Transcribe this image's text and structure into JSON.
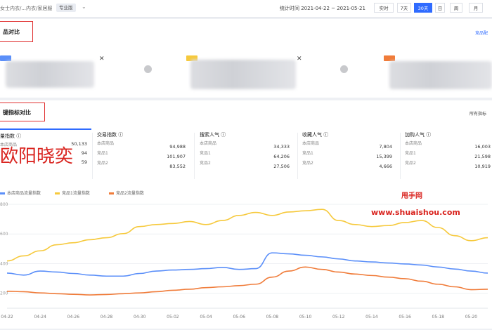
{
  "topbar": {
    "breadcrumb": "女士内衣/...内衣/家居服",
    "badge": "专业版",
    "stat_time": "统计时间 2021-04-22 ~ 2021-05-21",
    "time_buttons": [
      "实时",
      "7天",
      "30天",
      "日",
      "周",
      "月"
    ],
    "active_button": "30天"
  },
  "product_compare": {
    "title": "品对比",
    "link": "竞品配",
    "cards": [
      {
        "tag_color": "#5b8ff9"
      },
      {
        "tag_color": "#f6c93c"
      },
      {
        "tag_color": "#f07c3a"
      }
    ]
  },
  "metric_compare": {
    "title": "键指标对比",
    "link": "所有指标",
    "row_labels": [
      "本店商品",
      "竞品1",
      "竞品2"
    ],
    "metrics": [
      {
        "name": "量指数 ⓘ",
        "values": [
          "50,133",
          "94",
          "59"
        ]
      },
      {
        "name": "交易指数 ⓘ",
        "values": [
          "94,988",
          "101,907",
          "83,552"
        ]
      },
      {
        "name": "搜索人气 ⓘ",
        "values": [
          "34,333",
          "64,206",
          "27,506"
        ]
      },
      {
        "name": "收藏人气 ⓘ",
        "values": [
          "7,804",
          "15,399",
          "4,666"
        ]
      },
      {
        "name": "加购人气 ⓘ",
        "values": [
          "16,003",
          "21,598",
          "10,919"
        ]
      }
    ]
  },
  "watermarks": {
    "name": "欧阳晓奕",
    "site_cn": "甩手网",
    "site_url": "www.shuaishou.com"
  },
  "chart_data": {
    "type": "line",
    "x": [
      "04-22",
      "04-23",
      "04-24",
      "04-25",
      "04-26",
      "04-27",
      "04-28",
      "04-29",
      "04-30",
      "05-01",
      "05-02",
      "05-03",
      "05-04",
      "05-05",
      "05-06",
      "05-07",
      "05-08",
      "05-09",
      "05-10",
      "05-11",
      "05-12",
      "05-13",
      "05-14",
      "05-15",
      "05-16",
      "05-17",
      "05-18",
      "05-19",
      "05-20",
      "05-21"
    ],
    "x_tick_labels": [
      "04-22",
      "04-24",
      "04-26",
      "04-28",
      "04-30",
      "05-02",
      "05-04",
      "05-06",
      "05-08",
      "05-10",
      "05-12",
      "05-14",
      "05-16",
      "05-18",
      "05-20"
    ],
    "y_tick_labels": [
      "800",
      "600",
      "400",
      "200"
    ],
    "series": [
      {
        "name": "本店商品流量指数",
        "color": "#5b8ff9",
        "values": [
          460,
          450,
          470,
          465,
          458,
          450,
          445,
          445,
          458,
          470,
          475,
          478,
          482,
          488,
          478,
          482,
          560,
          555,
          548,
          540,
          530,
          520,
          515,
          510,
          505,
          500,
          490,
          480,
          470,
          460
        ]
      },
      {
        "name": "竞品1流量指数",
        "color": "#f6c93c",
        "values": [
          520,
          545,
          570,
          600,
          610,
          625,
          635,
          655,
          690,
          700,
          705,
          715,
          700,
          720,
          745,
          760,
          745,
          762,
          768,
          775,
          720,
          700,
          690,
          695,
          710,
          720,
          685,
          645,
          620,
          635
        ]
      },
      {
        "name": "竞品2流量指数",
        "color": "#f07c3a",
        "values": [
          370,
          368,
          362,
          358,
          355,
          352,
          354,
          358,
          362,
          368,
          375,
          380,
          388,
          392,
          398,
          405,
          440,
          470,
          490,
          478,
          465,
          455,
          448,
          440,
          432,
          420,
          405,
          392,
          378,
          380
        ]
      }
    ],
    "ylim": [
      300,
      800
    ]
  }
}
